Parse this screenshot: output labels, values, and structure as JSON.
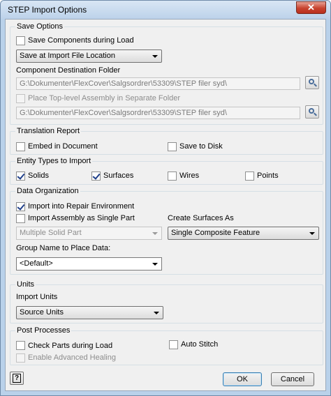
{
  "window": {
    "title": "STEP Import Options",
    "close_glyph": "✕"
  },
  "save_options": {
    "title": "Save Options",
    "save_components_label": "Save Components during Load",
    "save_location": "Save at Import File Location",
    "destination_label": "Component Destination Folder",
    "destination_path": "G:\\Dokumenter\\FlexCover\\Salgsordrer\\53309\\STEP filer syd\\",
    "top_level_label": "Place Top-level Assembly in Separate Folder",
    "top_level_path": "G:\\Dokumenter\\FlexCover\\Salgsordrer\\53309\\STEP filer syd\\"
  },
  "translation_report": {
    "title": "Translation Report",
    "embed_label": "Embed in Document",
    "save_disk_label": "Save to Disk"
  },
  "entity_types": {
    "title": "Entity Types to Import",
    "solids": "Solids",
    "surfaces": "Surfaces",
    "wires": "Wires",
    "points": "Points"
  },
  "data_organization": {
    "title": "Data Organization",
    "repair_label": "Import into Repair Environment",
    "single_part_label": "Import Assembly as Single Part",
    "create_surfaces_label": "Create Surfaces As",
    "part_type": "Multiple Solid Part",
    "surface_type": "Single Composite Feature",
    "group_name_label": "Group Name to Place Data:",
    "group_name": "<Default>"
  },
  "units": {
    "title": "Units",
    "import_units_label": "Import Units",
    "import_units": "Source Units"
  },
  "post_processes": {
    "title": "Post Processes",
    "check_parts_label": "Check Parts during Load",
    "auto_stitch_label": "Auto Stitch",
    "healing_label": "Enable Advanced Healing"
  },
  "buttons": {
    "help": "?",
    "ok": "OK",
    "cancel": "Cancel"
  },
  "states": {
    "save_components": false,
    "top_level": false,
    "embed": false,
    "save_disk": false,
    "solids": true,
    "surfaces": true,
    "wires": false,
    "points": false,
    "repair": true,
    "single_part": false,
    "check_parts": false,
    "auto_stitch": false,
    "healing": false
  },
  "icons": {
    "browse": "magnifier-icon",
    "help": "help-icon",
    "close": "close-icon",
    "dropdown": "chevron-down-icon"
  }
}
